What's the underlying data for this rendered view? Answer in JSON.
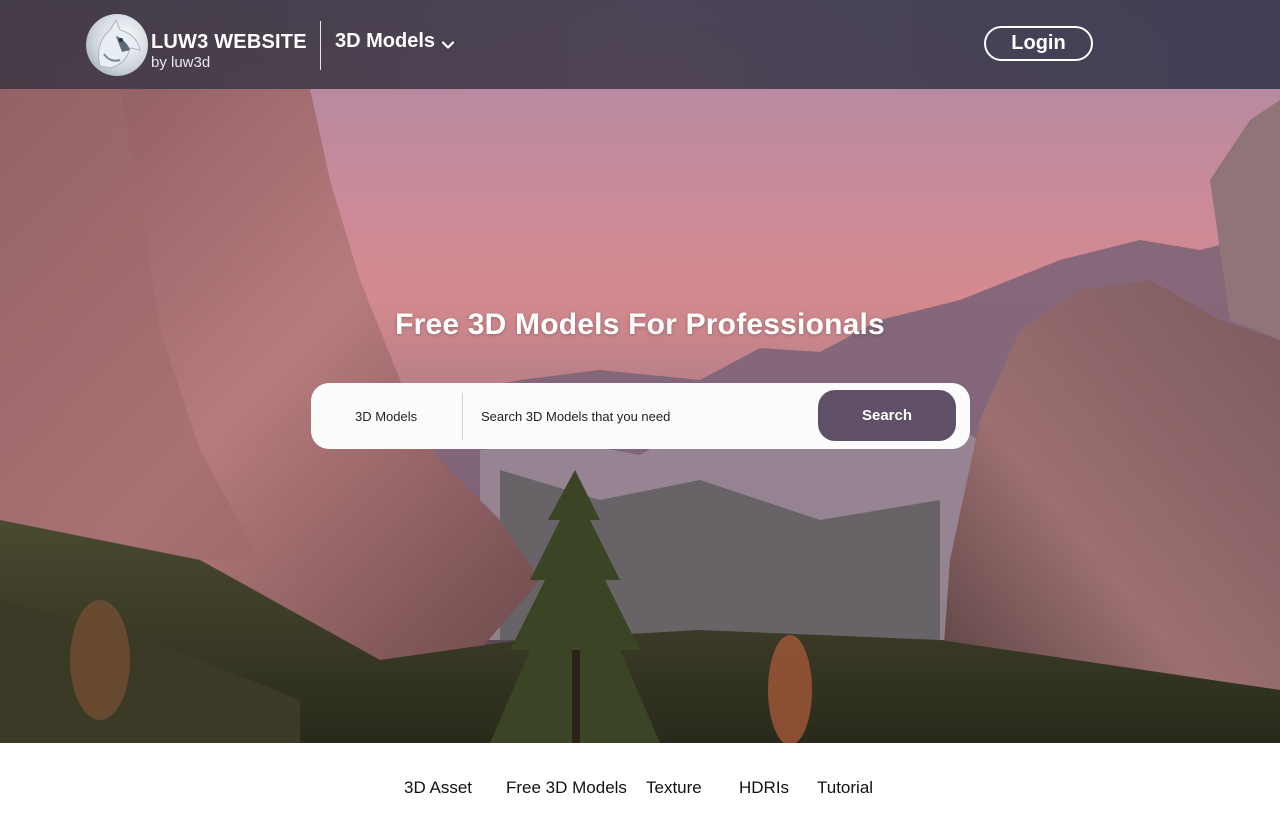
{
  "header": {
    "logo_title": "LUW3 WEBSITE",
    "logo_subtitle": "by luw3d",
    "category_label": "3D Models",
    "login_label": "Login"
  },
  "hero": {
    "title": "Free 3D Models For Professionals",
    "search": {
      "category": "3D Models",
      "placeholder": "Search 3D Models that you need",
      "button_label": "Search"
    }
  },
  "nav": {
    "items": [
      {
        "label": "3D Asset"
      },
      {
        "label": "Free 3D Models"
      },
      {
        "label": "Texture"
      },
      {
        "label": "HDRIs"
      },
      {
        "label": "Tutorial"
      }
    ]
  },
  "colors": {
    "accent": "#5f5068",
    "header_bg": "#37343f",
    "text_dark": "#111111"
  },
  "icons": {
    "logo": "wolf-logo-icon",
    "dropdown": "chevron-down-icon"
  }
}
